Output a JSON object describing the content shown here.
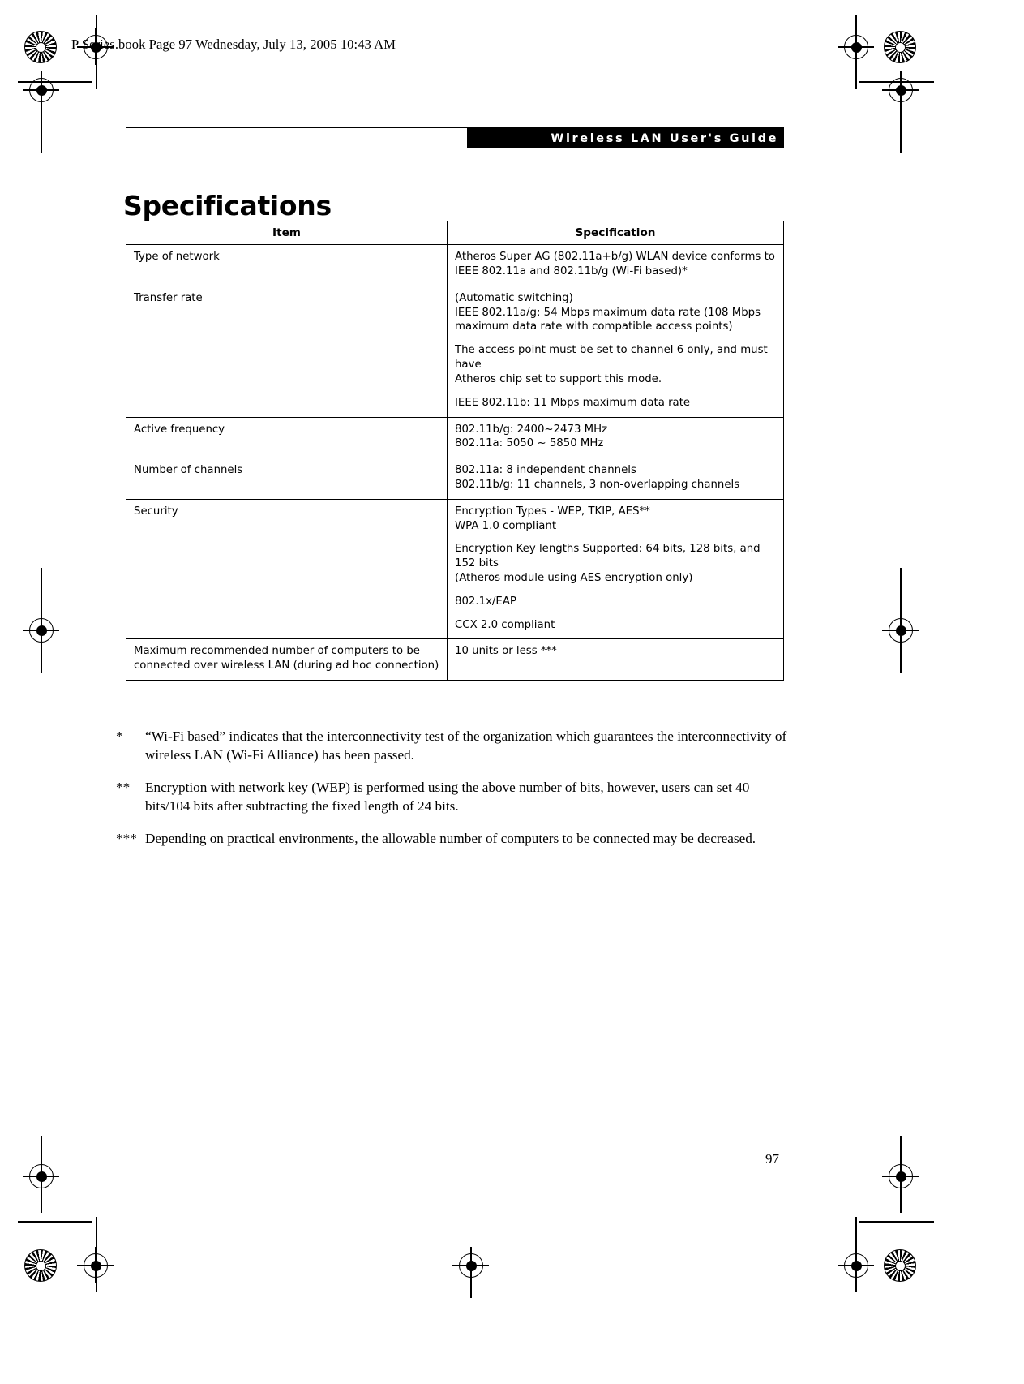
{
  "slug": "P Series.book  Page 97  Wednesday, July 13, 2005  10:43 AM",
  "running_head": "Wireless LAN User's Guide",
  "title": "Specifications",
  "page_number": "97",
  "table": {
    "headers": [
      "Item",
      "Specification"
    ],
    "rows": [
      {
        "item": "Type of network",
        "spec_blocks": [
          [
            "Atheros Super AG (802.11a+b/g) WLAN device conforms to",
            "IEEE 802.11a and 802.11b/g (Wi-Fi based)*"
          ]
        ]
      },
      {
        "item": "Transfer rate",
        "spec_blocks": [
          [
            "(Automatic switching)",
            "IEEE 802.11a/g: 54 Mbps maximum data rate (108 Mbps",
            "maximum data rate with compatible access points)"
          ],
          [
            "The access point must be set to channel 6 only, and must have",
            "Atheros chip set to support this mode."
          ],
          [
            "IEEE 802.11b: 11 Mbps maximum data rate"
          ]
        ]
      },
      {
        "item": "Active frequency",
        "spec_blocks": [
          [
            "802.11b/g: 2400~2473 MHz",
            "802.11a: 5050 ~ 5850 MHz"
          ]
        ]
      },
      {
        "item": "Number of channels",
        "spec_blocks": [
          [
            "802.11a: 8 independent channels",
            "802.11b/g: 11 channels, 3 non-overlapping channels"
          ]
        ]
      },
      {
        "item": "Security",
        "spec_blocks": [
          [
            "Encryption Types - WEP, TKIP, AES**",
            "WPA 1.0 compliant"
          ],
          [
            "Encryption Key lengths Supported: 64 bits, 128 bits, and 152 bits",
            "(Atheros module using AES encryption only)"
          ],
          [
            "802.1x/EAP"
          ],
          [
            "CCX 2.0 compliant"
          ]
        ]
      },
      {
        "item": "Maximum recommended number of computers to be connected over wireless LAN (during ad hoc connection)",
        "spec_blocks": [
          [
            "10 units or less ***"
          ]
        ]
      }
    ]
  },
  "footnotes": [
    {
      "mark": "*",
      "text": "“Wi-Fi based” indicates that the interconnectivity test of the organization which guarantees the interconnectivity of wireless LAN (Wi-Fi Alliance) has been passed."
    },
    {
      "mark": "**",
      "text": "Encryption with network key (WEP) is performed using the above number of bits, however, users can set 40 bits/104 bits after subtracting the fixed length of 24 bits."
    },
    {
      "mark": "***",
      "text": "Depending on practical environments, the allowable number of computers to be connected may be decreased."
    }
  ]
}
